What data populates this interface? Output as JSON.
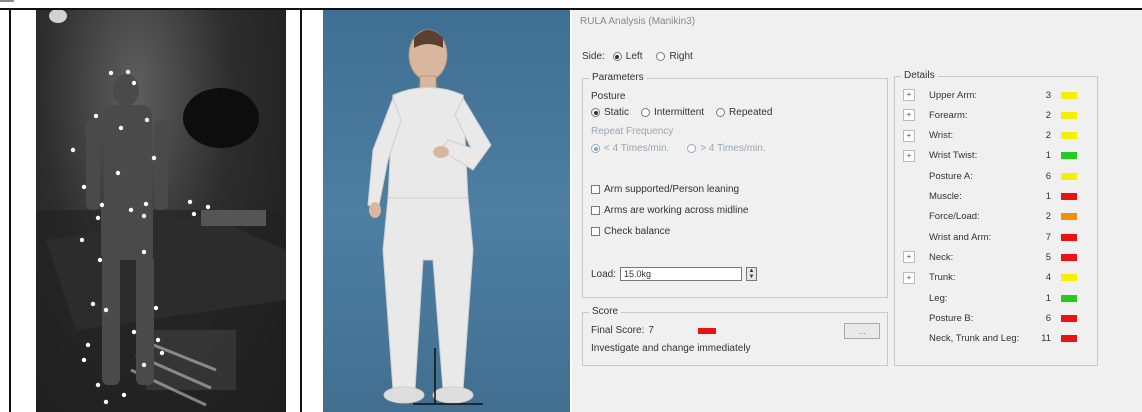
{
  "window_title": "RULA Analysis (Manikin3)",
  "side": {
    "label": "Side:",
    "options": [
      {
        "label": "Left",
        "selected": true
      },
      {
        "label": "Right",
        "selected": false
      }
    ]
  },
  "parameters": {
    "legend": "Parameters",
    "posture_label": "Posture",
    "posture_options": [
      {
        "label": "Static",
        "selected": true
      },
      {
        "label": "Intermittent",
        "selected": false
      },
      {
        "label": "Repeated",
        "selected": false
      }
    ],
    "repeat_frequency_label": "Repeat Frequency",
    "repeat_options": [
      {
        "label": "< 4 Times/min.",
        "selected": true
      },
      {
        "label": "> 4 Times/min.",
        "selected": false
      }
    ],
    "checkboxes": [
      {
        "label": "Arm supported/Person leaning",
        "checked": false
      },
      {
        "label": "Arms are working across midline",
        "checked": false
      },
      {
        "label": "Check balance",
        "checked": false
      }
    ],
    "load_label": "Load:",
    "load_value": "15.0kg"
  },
  "score": {
    "legend": "Score",
    "final_label": "Final Score:",
    "final_value": "7",
    "final_color": "#ee1111",
    "message": "Investigate and change immediately",
    "details_button": "..."
  },
  "details": {
    "legend": "Details",
    "rows": [
      {
        "label": "Upper Arm:",
        "value": "3",
        "color": "#f5f000",
        "expander": "+"
      },
      {
        "label": "Forearm:",
        "value": "2",
        "color": "#f5f000",
        "expander": "+"
      },
      {
        "label": "Wrist:",
        "value": "2",
        "color": "#f5f000",
        "expander": "+"
      },
      {
        "label": "Wrist Twist:",
        "value": "1",
        "color": "#22cc22",
        "expander": "+"
      },
      {
        "label": "Posture A:",
        "value": "6",
        "color": "#f5f000",
        "expander": ""
      },
      {
        "label": "Muscle:",
        "value": "1",
        "color": "#ee1111",
        "expander": ""
      },
      {
        "label": "Force/Load:",
        "value": "2",
        "color": "#f59000",
        "expander": ""
      },
      {
        "label": "Wrist and Arm:",
        "value": "7",
        "color": "#ee1111",
        "expander": ""
      },
      {
        "label": "Neck:",
        "value": "5",
        "color": "#ee1111",
        "expander": "+"
      },
      {
        "label": "Trunk:",
        "value": "4",
        "color": "#f5f000",
        "expander": "+"
      },
      {
        "label": "Leg:",
        "value": "1",
        "color": "#22cc22",
        "expander": ""
      },
      {
        "label": "Posture B:",
        "value": "6",
        "color": "#ee1111",
        "expander": ""
      },
      {
        "label": "Neck, Trunk and Leg:",
        "value": "11",
        "color": "#ee1111",
        "expander": ""
      }
    ]
  },
  "icons": {
    "camera_panel": "pose-keypoint-camera-image",
    "model_panel": "3d-manikin-render",
    "spinner": "spin-up-down-icon"
  }
}
